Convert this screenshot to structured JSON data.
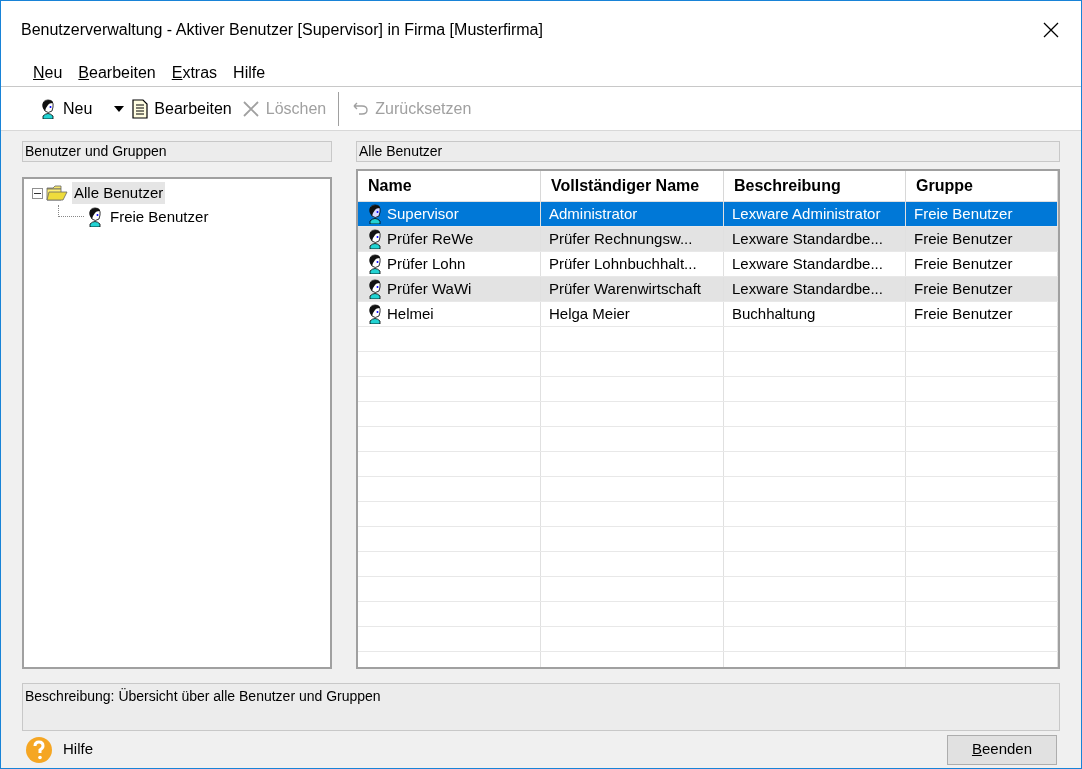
{
  "window": {
    "title": "Benutzerverwaltung - Aktiver Benutzer [Supervisor] in Firma [Musterfirma]"
  },
  "menu": [
    {
      "label": "Neu",
      "underline_first": true
    },
    {
      "label": "Bearbeiten",
      "underline_first": true
    },
    {
      "label": "Extras",
      "underline_first": true
    },
    {
      "label": "Hilfe",
      "underline_first": false
    }
  ],
  "toolbar": [
    {
      "kind": "user",
      "label": "Neu",
      "disabled": false,
      "dropdown": true
    },
    {
      "kind": "document",
      "label": "Bearbeiten",
      "disabled": false,
      "dropdown": false
    },
    {
      "kind": "delete",
      "label": "Löschen",
      "disabled": true,
      "dropdown": false
    },
    {
      "kind": "separator"
    },
    {
      "kind": "undo",
      "label": "Zurücksetzen",
      "disabled": true,
      "dropdown": false
    }
  ],
  "left_panel": {
    "header": "Benutzer und Gruppen",
    "tree": [
      {
        "kind": "folder",
        "label": "Alle Benutzer",
        "selected": true,
        "expanded": true,
        "children": [
          {
            "kind": "user",
            "label": "Freie Benutzer",
            "selected": false
          }
        ]
      }
    ]
  },
  "right_panel": {
    "header": "Alle Benutzer",
    "table": {
      "columns": [
        "Name",
        "Vollständiger Name",
        "Beschreibung",
        "Gruppe"
      ],
      "rows": [
        {
          "selected": true,
          "cells": [
            "Supervisor",
            "Administrator",
            "Lexware Administrator",
            "Freie Benutzer"
          ]
        },
        {
          "selected": false,
          "cells": [
            "Prüfer ReWe",
            "Prüfer Rechnungsw...",
            "Lexware Standardbe...",
            "Freie Benutzer"
          ]
        },
        {
          "selected": false,
          "cells": [
            "Prüfer Lohn",
            "Prüfer Lohnbuchhalt...",
            "Lexware Standardbe...",
            "Freie Benutzer"
          ]
        },
        {
          "selected": false,
          "cells": [
            "Prüfer WaWi",
            "Prüfer Warenwirtschaft",
            "Lexware Standardbe...",
            "Freie Benutzer"
          ]
        },
        {
          "selected": false,
          "cells": [
            "Helmei",
            "Helga Meier",
            "Buchhaltung",
            "Freie Benutzer"
          ]
        }
      ]
    }
  },
  "description": "Beschreibung: Übersicht über alle Benutzer und Gruppen",
  "footer": {
    "help": "Hilfe",
    "button": {
      "label": "Beenden",
      "underline_first": true
    }
  }
}
